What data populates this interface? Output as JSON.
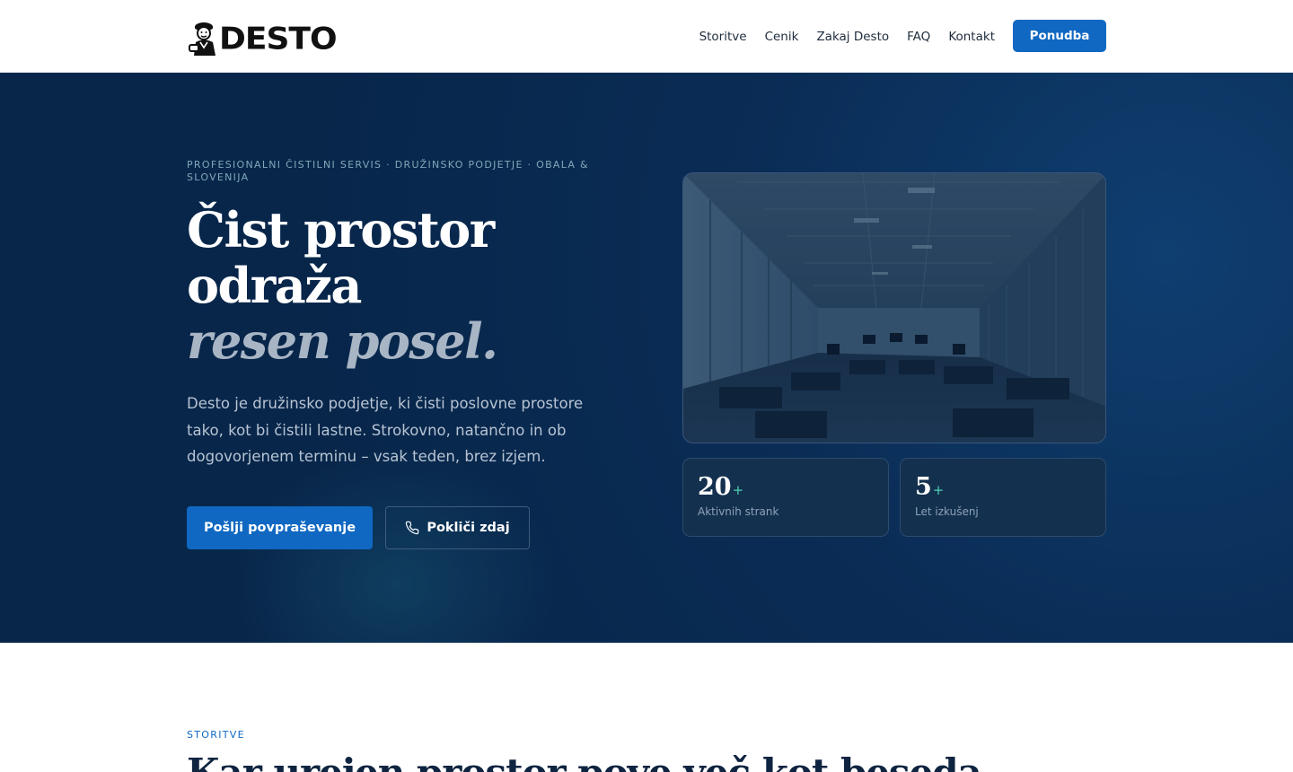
{
  "header": {
    "logo_text": "DESTO",
    "nav": [
      "Storitve",
      "Cenik",
      "Zakaj Desto",
      "FAQ",
      "Kontakt"
    ],
    "cta_label": "Ponudba",
    "accent_color": "#1068c2"
  },
  "hero": {
    "eyebrow": "PROFESIONALNI ČISTILNI SERVIS · DRUŽINSKO PODJETJE · OBALA & SLOVENIJA",
    "headline_line1": "Čist prostor",
    "headline_line2": "odraža",
    "headline_accent": "resen posel.",
    "lead": "Desto je družinsko podjetje, ki čisti poslovne prostore tako, kot bi čistili lastne. Strokovno, natančno in ob dogovorjenem terminu – vsak teden, brez izjem.",
    "primary_cta": "Pošlji povpraševanje",
    "secondary_cta": "Pokliči zdaj",
    "secondary_cta_icon": "phone-icon",
    "background_color": "#08264a",
    "stats": [
      {
        "value": "20",
        "suffix": "+",
        "label": "Aktivnih strank"
      },
      {
        "value": "5",
        "suffix": "+",
        "label": "Let izkušenj"
      }
    ]
  },
  "services": {
    "eyebrow": "STORITVE",
    "title": "Kar urejen prostor pove več kot beseda"
  }
}
